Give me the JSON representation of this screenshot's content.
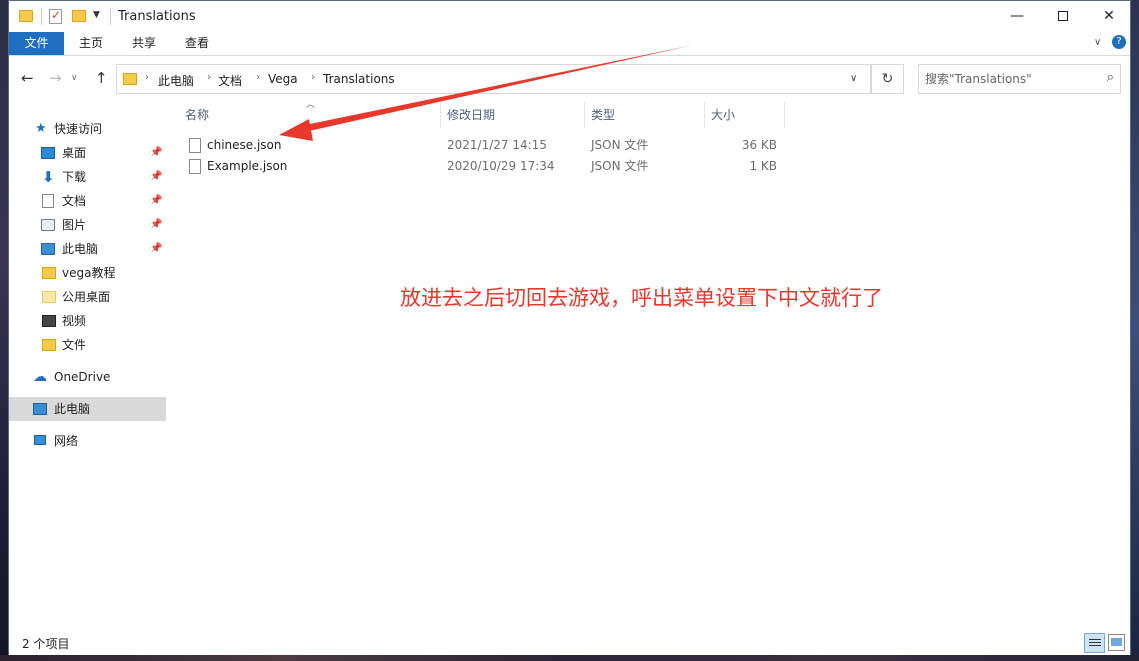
{
  "window": {
    "title": "Translations",
    "controls": {
      "minimize": "—",
      "close": "✕"
    }
  },
  "ribbon": {
    "tabs": [
      "文件",
      "主页",
      "共享",
      "查看"
    ]
  },
  "address": {
    "breadcrumbs": [
      "此电脑",
      "文档",
      "Vega",
      "Translations"
    ],
    "search_placeholder": "搜索\"Translations\""
  },
  "sidebar": {
    "quick_access": "快速访问",
    "items": [
      {
        "label": "桌面",
        "icon": "desktop-icon",
        "pinned": true
      },
      {
        "label": "下载",
        "icon": "download-icon",
        "pinned": true
      },
      {
        "label": "文档",
        "icon": "documents-icon",
        "pinned": true
      },
      {
        "label": "图片",
        "icon": "pictures-icon",
        "pinned": true
      },
      {
        "label": "此电脑",
        "icon": "pc-icon",
        "pinned": true
      },
      {
        "label": "vega教程",
        "icon": "folder-icon",
        "pinned": false
      },
      {
        "label": "公用桌面",
        "icon": "folder-icon",
        "pinned": false
      },
      {
        "label": "视频",
        "icon": "video-icon",
        "pinned": false
      },
      {
        "label": "文件",
        "icon": "folder-icon",
        "pinned": false
      }
    ],
    "onedrive": "OneDrive",
    "this_pc": "此电脑",
    "network": "网络"
  },
  "file_list": {
    "columns": [
      "名称",
      "修改日期",
      "类型",
      "大小"
    ],
    "rows": [
      {
        "name": "chinese.json",
        "date": "2021/1/27 14:15",
        "type": "JSON 文件",
        "size": "36 KB"
      },
      {
        "name": "Example.json",
        "date": "2020/10/29 17:34",
        "type": "JSON 文件",
        "size": "1 KB"
      }
    ]
  },
  "annotation": {
    "text": "放进去之后切回去游戏，呼出菜单设置下中文就行了",
    "color": "#e8382c"
  },
  "status": {
    "item_count": "2 个项目"
  },
  "colors": {
    "accent": "#1e6fbf",
    "selected_bg": "#d9d9d9",
    "folder": "#f5c94a"
  }
}
